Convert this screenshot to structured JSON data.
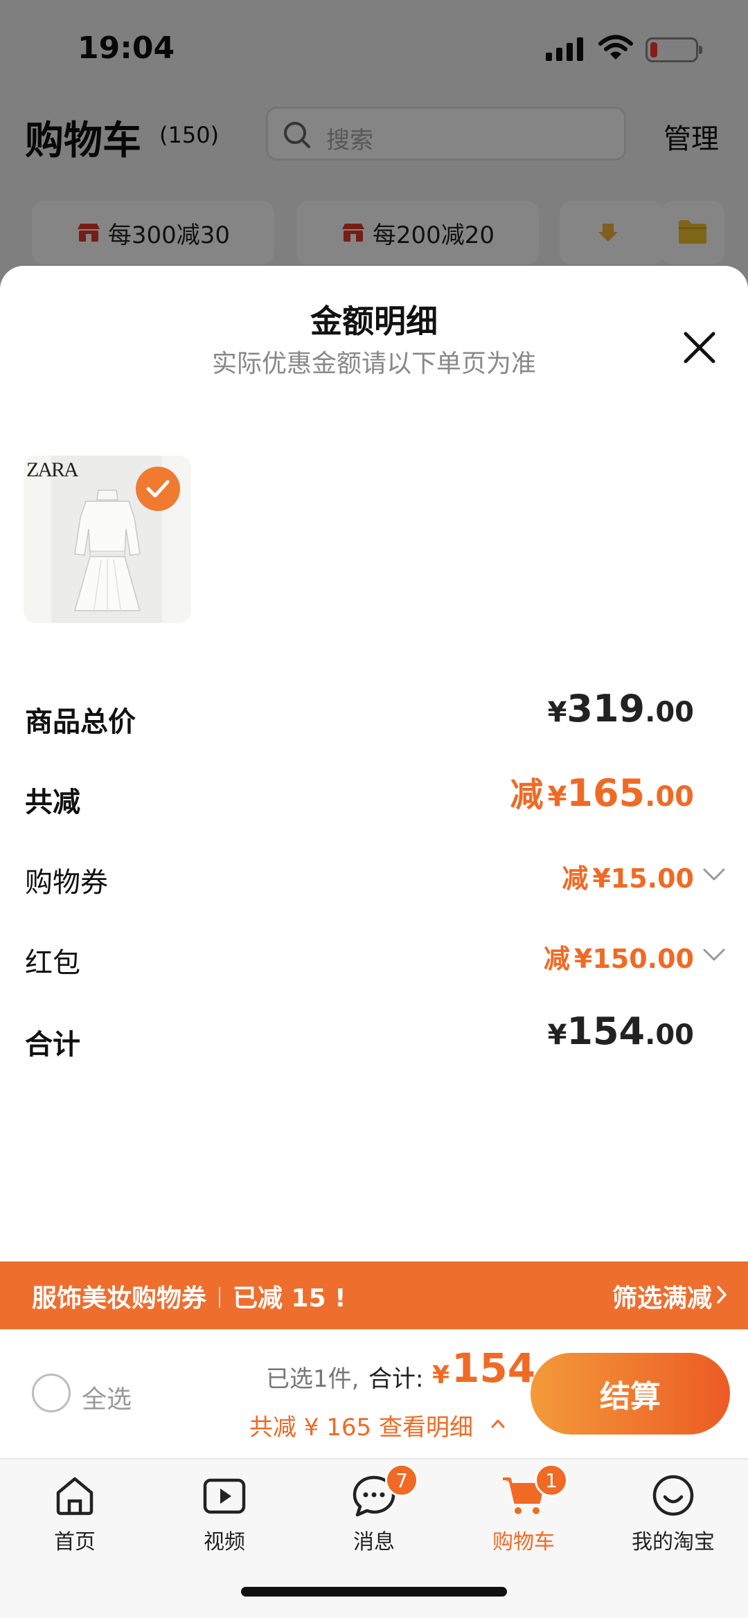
{
  "status": {
    "time": "19:04"
  },
  "header": {
    "title": "购物车",
    "count": "(150)",
    "search_placeholder": "搜索",
    "manage": "管理"
  },
  "promos": [
    "每300减30",
    "每200减20"
  ],
  "sheet": {
    "title": "金额明细",
    "subtitle": "实际优惠金额请以下单页为准",
    "product": {
      "brand": "ZARA",
      "selected": true
    },
    "rows": {
      "subtotal": {
        "label": "商品总价",
        "currency": "¥",
        "int": "319",
        "dec": ".00"
      },
      "discount": {
        "label": "共减",
        "minus": "减",
        "currency": "¥",
        "int": "165",
        "dec": ".00"
      },
      "coupon": {
        "label": "购物券",
        "minus": "减",
        "currency": "¥",
        "int": "15",
        "dec": ".00"
      },
      "redpacket": {
        "label": "红包",
        "minus": "减",
        "currency": "¥",
        "int": "150",
        "dec": ".00"
      },
      "total": {
        "label": "合计",
        "currency": "¥",
        "int": "154",
        "dec": ".00"
      }
    }
  },
  "banner": {
    "left": "服饰美妆购物券",
    "saved": "已减 15 !",
    "right": "筛选满减"
  },
  "checkout": {
    "select_all": "全选",
    "selected": "已选1件,",
    "total_label": "合计:",
    "currency": "¥",
    "total": "154",
    "saved_line": "共减 ¥ 165  查看明细",
    "button": "结算"
  },
  "tabs": [
    {
      "label": "首页",
      "icon": "home-icon"
    },
    {
      "label": "视频",
      "icon": "video-icon"
    },
    {
      "label": "消息",
      "icon": "message-icon",
      "badge": "7"
    },
    {
      "label": "购物车",
      "icon": "cart-icon",
      "badge": "1",
      "active": true
    },
    {
      "label": "我的淘宝",
      "icon": "profile-icon"
    }
  ],
  "colors": {
    "accent": "#f06a24",
    "banner": "#ee6e2e",
    "button_start": "#f39a3a",
    "button_end": "#ec5b24"
  }
}
